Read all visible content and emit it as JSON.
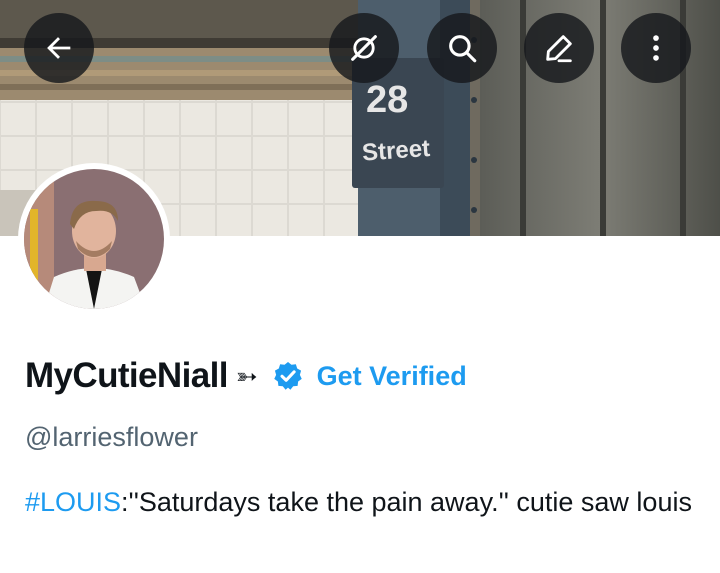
{
  "header": {
    "banner_station_number": "28",
    "banner_station_label": "Street",
    "buttons": [
      {
        "name": "back",
        "icon": "arrow-left-icon"
      },
      {
        "name": "grok",
        "icon": "grok-icon"
      },
      {
        "name": "search",
        "icon": "search-icon"
      },
      {
        "name": "edit",
        "icon": "pencil-icon"
      },
      {
        "name": "more",
        "icon": "more-vertical-icon"
      }
    ]
  },
  "profile": {
    "display_name": "MyCutieNiall",
    "name_suffix": "➳",
    "get_verified_label": "Get Verified",
    "handle": "@larriesflower",
    "bio_hashtag": "#LOUIS",
    "bio_text": ":''Saturdays take the pain away.''  cutie saw louis"
  },
  "colors": {
    "accent": "#1d9bf0",
    "text_primary": "#0f1419",
    "text_secondary": "#536471",
    "icon_button_bg": "#16181c"
  }
}
